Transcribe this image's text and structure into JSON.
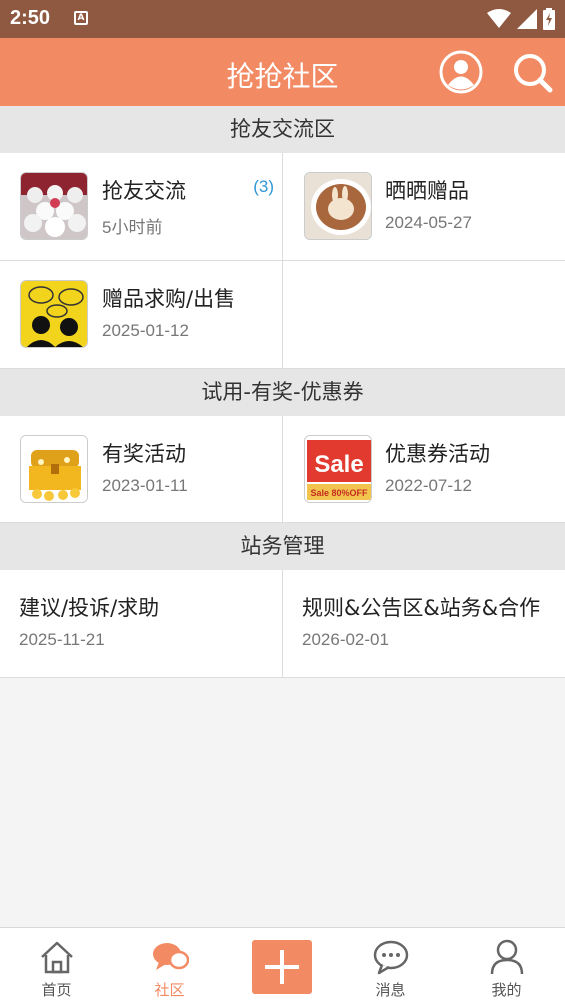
{
  "status_bar": {
    "time": "2:50",
    "notification_letter": "A"
  },
  "header": {
    "title": "抢抢社区"
  },
  "sections": [
    {
      "title": "抢友交流区",
      "items": [
        {
          "title": "抢友交流",
          "date": "5小时前",
          "count": "(3)",
          "icon": "crowd-thumbnail"
        },
        {
          "title": "晒晒赠品",
          "date": "2024-05-27",
          "icon": "coffee-thumbnail"
        },
        {
          "title": "赠品求购/出售",
          "date": "2025-01-12",
          "icon": "chat-heads-thumbnail"
        }
      ]
    },
    {
      "title": "试用-有奖-优惠券",
      "items": [
        {
          "title": "有奖活动",
          "date": "2023-01-11",
          "icon": "treasure-chest-thumbnail"
        },
        {
          "title": "优惠券活动",
          "date": "2022-07-12",
          "icon": "sale-thumbnail",
          "thumb_text": "Sale",
          "thumb_subtext": "Sale 80%OFF"
        }
      ]
    },
    {
      "title": "站务管理",
      "items": [
        {
          "title": "建议/投诉/求助",
          "date": "2025-11-21"
        },
        {
          "title": "规则&公告区&站务&合作",
          "date": "2026-02-01"
        }
      ]
    }
  ],
  "tab_bar": {
    "tabs": [
      {
        "label": "首页",
        "icon": "home-icon"
      },
      {
        "label": "社区",
        "icon": "chat-bubbles-icon",
        "active": true
      },
      {
        "label": "",
        "icon": "plus-icon"
      },
      {
        "label": "消息",
        "icon": "message-icon"
      },
      {
        "label": "我的",
        "icon": "user-icon"
      }
    ]
  },
  "colors": {
    "accent": "#f28a63",
    "status_bar": "#8f5841",
    "count": "#2f97d8"
  }
}
